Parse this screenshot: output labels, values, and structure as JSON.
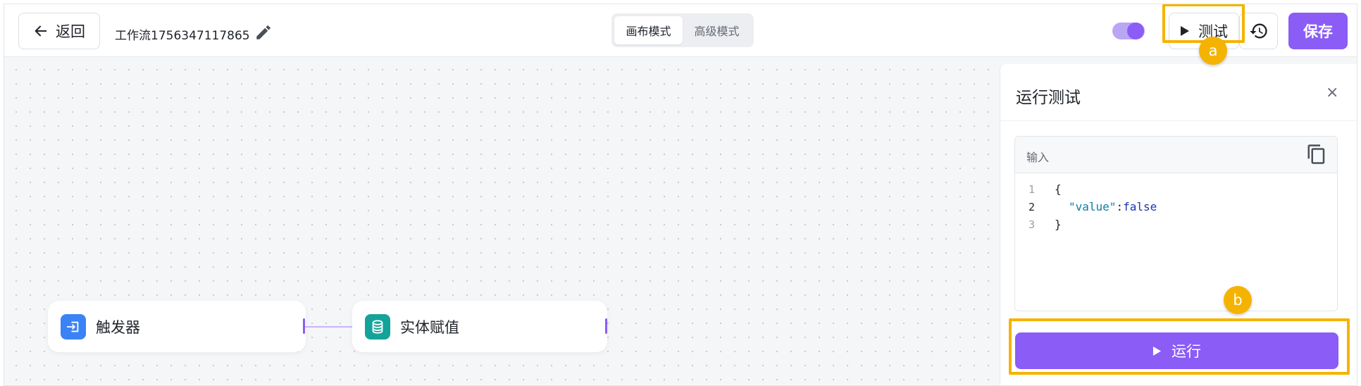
{
  "header": {
    "back_label": "返回",
    "workflow_title": "工作流1756347117865",
    "modes": [
      {
        "label": "画布模式",
        "active": true
      },
      {
        "label": "高级模式",
        "active": false
      }
    ],
    "toggle_on": true,
    "test_label": "测试",
    "save_label": "保存"
  },
  "canvas": {
    "nodes": [
      {
        "label": "触发器",
        "icon": "trigger-icon"
      },
      {
        "label": "实体赋值",
        "icon": "database-icon"
      }
    ]
  },
  "test_panel": {
    "title": "运行测试",
    "close_glyph": "×",
    "input_label": "输入",
    "code_lines": [
      {
        "num": "1",
        "text": "{"
      },
      {
        "num": "2",
        "key": "\"value\"",
        "sep": ":",
        "val": "false"
      },
      {
        "num": "3",
        "text": "}"
      }
    ],
    "run_label": "运行"
  },
  "annotations": {
    "a": "a",
    "b": "b"
  },
  "colors": {
    "accent": "#8b5cf6",
    "highlight": "#f5b301",
    "trigger_icon_bg": "#3b82f6",
    "entity_icon_bg": "#14a39a"
  }
}
